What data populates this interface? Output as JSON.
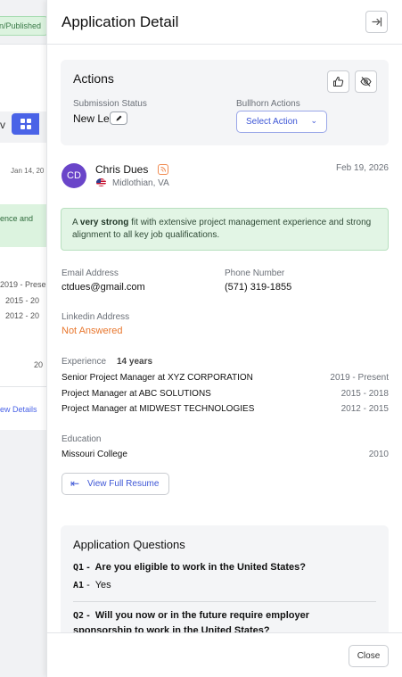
{
  "background": {
    "status_pill": "n/Published",
    "date": "Jan 14, 20",
    "snippet": "ence and",
    "years": [
      "2019 - Prese",
      "2015 - 20",
      "2012 - 20",
      "20"
    ],
    "view_details": "ew Details",
    "view_letter": "v"
  },
  "drawer": {
    "title": "Application Detail",
    "actions": {
      "title": "Actions",
      "submission_status_label": "Submission Status",
      "submission_status_value": "New Lead",
      "bullhorn_label": "Bullhorn Actions",
      "select_action": "Select Action"
    },
    "candidate": {
      "initials": "CD",
      "name": "Chris Dues",
      "location": "Midlothian, VA",
      "date": "Feb 19, 2026"
    },
    "fit": {
      "prefix": "A ",
      "strong": "very strong",
      "rest": " fit with extensive project management experience and strong alignment to all key job qualifications."
    },
    "email_label": "Email Address",
    "email": "ctdues@gmail.com",
    "phone_label": "Phone Number",
    "phone": "(571) 319-1855",
    "linkedin_label": "Linkedin Address",
    "linkedin": "Not Answered",
    "experience_label": "Experience",
    "experience_years": "14 years",
    "experience": [
      {
        "role": "Senior Project Manager at XYZ CORPORATION",
        "period": "2019 - Present"
      },
      {
        "role": "Project Manager at ABC SOLUTIONS",
        "period": "2015 - 2018"
      },
      {
        "role": "Project Manager at MIDWEST TECHNOLOGIES",
        "period": "2012 - 2015"
      }
    ],
    "education_label": "Education",
    "education": {
      "school": "Missouri College",
      "year": "2010"
    },
    "view_resume": "View Full Resume",
    "questions": {
      "title": "Application Questions",
      "q1_num": "Q1",
      "q1": "Are you eligible to work in the United States?",
      "a1_num": "A1",
      "a1": "Yes",
      "q2_num": "Q2",
      "q2_line1": "Will you now or in the future require employer",
      "q2_line2": "sponsorship to work in the United States?"
    },
    "close": "Close"
  },
  "colors": {
    "accent": "#3d56d6",
    "avatar": "#6a45c9",
    "not_answered": "#e8772e",
    "fit_bg": "#e2f5e5"
  }
}
